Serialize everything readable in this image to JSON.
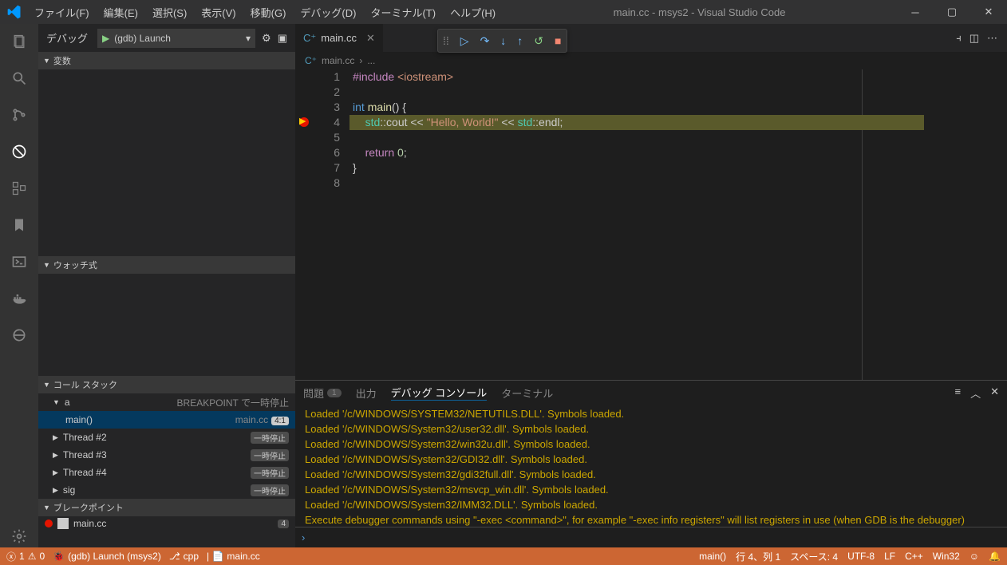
{
  "window": {
    "title": "main.cc - msys2 - Visual Studio Code"
  },
  "menus": [
    "ファイル(F)",
    "編集(E)",
    "選択(S)",
    "表示(V)",
    "移動(G)",
    "デバッグ(D)",
    "ターミナル(T)",
    "ヘルプ(H)"
  ],
  "sidebar": {
    "title": "デバッグ",
    "launch": "(gdb) Launch",
    "sections": {
      "variables": "変数",
      "watch": "ウォッチ式",
      "callstack": "コール スタック",
      "breakpoints": "ブレークポイント"
    },
    "cs": {
      "proc": "a",
      "proc_state": "BREAKPOINT で一時停止",
      "frame": "main()",
      "frame_file": "main.cc",
      "frame_loc": "4:1",
      "threads": [
        {
          "label": "Thread #2",
          "state": "一時停止"
        },
        {
          "label": "Thread #3",
          "state": "一時停止"
        },
        {
          "label": "Thread #4",
          "state": "一時停止"
        },
        {
          "label": "sig",
          "state": "一時停止"
        }
      ]
    },
    "bp": {
      "file": "main.cc",
      "line": "4"
    }
  },
  "tab": {
    "file": "main.cc"
  },
  "breadcrumb": {
    "file": "main.cc",
    "more": "..."
  },
  "code": {
    "lines": [
      "#include <iostream>",
      "",
      "int main() {",
      "    std::cout << \"Hello, World!\" << std::endl;",
      "",
      "    return 0;",
      "}",
      ""
    ]
  },
  "panel": {
    "tabs": {
      "problems": "問題",
      "problems_count": "1",
      "output": "出力",
      "debugconsole": "デバッグ コンソール",
      "terminal": "ターミナル"
    },
    "lines": [
      "Loaded '/c/WINDOWS/SYSTEM32/NETUTILS.DLL'. Symbols loaded.",
      "Loaded '/c/WINDOWS/System32/user32.dll'. Symbols loaded.",
      "Loaded '/c/WINDOWS/System32/win32u.dll'. Symbols loaded.",
      "Loaded '/c/WINDOWS/System32/GDI32.dll'. Symbols loaded.",
      "Loaded '/c/WINDOWS/System32/gdi32full.dll'. Symbols loaded.",
      "Loaded '/c/WINDOWS/System32/msvcp_win.dll'. Symbols loaded.",
      "Loaded '/c/WINDOWS/System32/IMM32.DLL'. Symbols loaded.",
      "Execute debugger commands using \"-exec <command>\", for example \"-exec info registers\" will list registers in use (when GDB is the debugger)"
    ]
  },
  "status": {
    "errors": "1",
    "warnings": "0",
    "launch": "(gdb) Launch (msys2)",
    "lang": "cpp",
    "file": "main.cc",
    "fn": "main()",
    "pos": "行 4、列 1",
    "spaces": "スペース: 4",
    "encoding": "UTF-8",
    "eol": "LF",
    "mode": "C++",
    "os": "Win32"
  }
}
